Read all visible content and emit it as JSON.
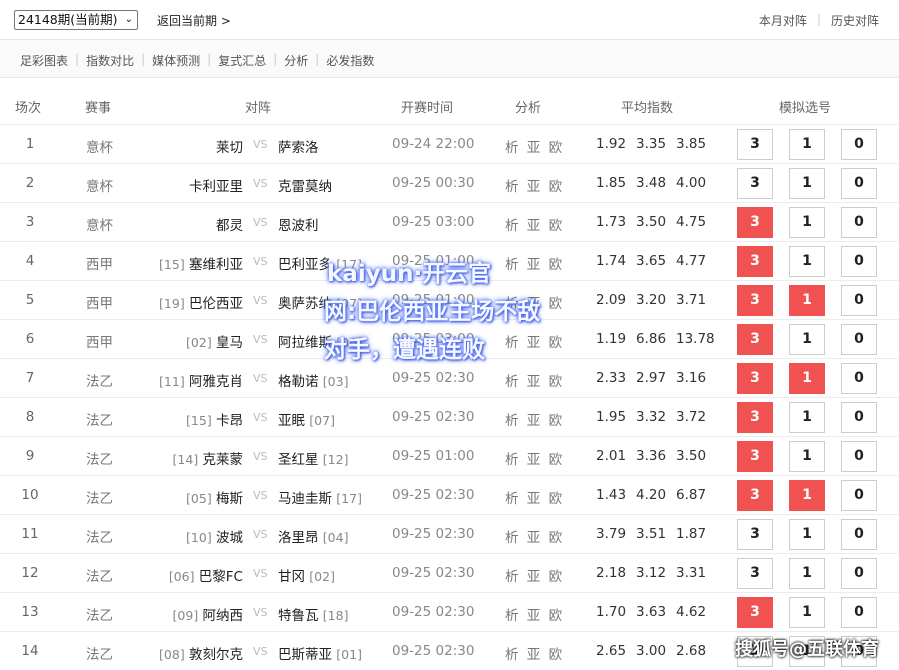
{
  "topbar": {
    "period_select": "24148期(当前期)",
    "period_arrow": "⌄",
    "back_link": "返回当前期 >",
    "right_links": [
      "本月对阵",
      "历史对阵"
    ]
  },
  "subnav": {
    "items": [
      "足彩图表",
      "指数对比",
      "媒体预测",
      "复式汇总",
      "分析",
      "必发指数"
    ]
  },
  "columns": {
    "idx": "场次",
    "league": "赛事",
    "match": "对阵",
    "time": "开赛时间",
    "analysis": "分析",
    "odds": "平均指数",
    "pick": "模拟选号"
  },
  "rows": [
    {
      "idx": "1",
      "league": "意杯",
      "home_rank": "",
      "home": "莱切",
      "vs": "VS",
      "away": "萨索洛",
      "away_rank": "",
      "time": "09-24 22:00",
      "analysis": "析 亚 欧",
      "odds": [
        "1.92",
        "3.35",
        "3.85"
      ],
      "pick": [
        "3",
        "1",
        "0"
      ],
      "selected": [
        false,
        false,
        false
      ]
    },
    {
      "idx": "2",
      "league": "意杯",
      "home_rank": "",
      "home": "卡利亚里",
      "vs": "VS",
      "away": "克雷莫纳",
      "away_rank": "",
      "time": "09-25 00:30",
      "analysis": "析 亚 欧",
      "odds": [
        "1.85",
        "3.48",
        "4.00"
      ],
      "pick": [
        "3",
        "1",
        "0"
      ],
      "selected": [
        false,
        false,
        false
      ]
    },
    {
      "idx": "3",
      "league": "意杯",
      "home_rank": "",
      "home": "都灵",
      "vs": "VS",
      "away": "恩波利",
      "away_rank": "",
      "time": "09-25 03:00",
      "analysis": "析 亚 欧",
      "odds": [
        "1.73",
        "3.50",
        "4.75"
      ],
      "pick": [
        "3",
        "1",
        "0"
      ],
      "selected": [
        true,
        false,
        false
      ]
    },
    {
      "idx": "4",
      "league": "西甲",
      "home_rank": "[15]",
      "home": "塞维利亚",
      "vs": "VS",
      "away": "巴利亚多",
      "away_rank": "[17]",
      "time": "09-25 01:00",
      "analysis": "析 亚 欧",
      "odds": [
        "1.74",
        "3.65",
        "4.77"
      ],
      "pick": [
        "3",
        "1",
        "0"
      ],
      "selected": [
        true,
        false,
        false
      ]
    },
    {
      "idx": "5",
      "league": "西甲",
      "home_rank": "[19]",
      "home": "巴伦西亚",
      "vs": "VS",
      "away": "奥萨苏纳",
      "away_rank": "[07]",
      "time": "09-25 01:00",
      "analysis": "析 亚 欧",
      "odds": [
        "2.09",
        "3.20",
        "3.71"
      ],
      "pick": [
        "3",
        "1",
        "0"
      ],
      "selected": [
        true,
        true,
        false
      ]
    },
    {
      "idx": "6",
      "league": "西甲",
      "home_rank": "[02]",
      "home": "皇马",
      "vs": "VS",
      "away": "阿拉维斯",
      "away_rank": "[06]",
      "time": "09-25 03:00",
      "analysis": "析 亚 欧",
      "odds": [
        "1.19",
        "6.86",
        "13.78"
      ],
      "pick": [
        "3",
        "1",
        "0"
      ],
      "selected": [
        true,
        false,
        false
      ]
    },
    {
      "idx": "7",
      "league": "法乙",
      "home_rank": "[11]",
      "home": "阿雅克肖",
      "vs": "VS",
      "away": "格勒诺",
      "away_rank": "[03]",
      "time": "09-25 02:30",
      "analysis": "析 亚 欧",
      "odds": [
        "2.33",
        "2.97",
        "3.16"
      ],
      "pick": [
        "3",
        "1",
        "0"
      ],
      "selected": [
        true,
        true,
        false
      ]
    },
    {
      "idx": "8",
      "league": "法乙",
      "home_rank": "[15]",
      "home": "卡昂",
      "vs": "VS",
      "away": "亚眠",
      "away_rank": "[07]",
      "time": "09-25 02:30",
      "analysis": "析 亚 欧",
      "odds": [
        "1.95",
        "3.32",
        "3.72"
      ],
      "pick": [
        "3",
        "1",
        "0"
      ],
      "selected": [
        true,
        false,
        false
      ]
    },
    {
      "idx": "9",
      "league": "法乙",
      "home_rank": "[14]",
      "home": "克莱蒙",
      "vs": "VS",
      "away": "圣红星",
      "away_rank": "[12]",
      "time": "09-25 01:00",
      "analysis": "析 亚 欧",
      "odds": [
        "2.01",
        "3.36",
        "3.50"
      ],
      "pick": [
        "3",
        "1",
        "0"
      ],
      "selected": [
        true,
        false,
        false
      ]
    },
    {
      "idx": "10",
      "league": "法乙",
      "home_rank": "[05]",
      "home": "梅斯",
      "vs": "VS",
      "away": "马迪圭斯",
      "away_rank": "[17]",
      "time": "09-25 02:30",
      "analysis": "析 亚 欧",
      "odds": [
        "1.43",
        "4.20",
        "6.87"
      ],
      "pick": [
        "3",
        "1",
        "0"
      ],
      "selected": [
        true,
        true,
        false
      ]
    },
    {
      "idx": "11",
      "league": "法乙",
      "home_rank": "[10]",
      "home": "波城",
      "vs": "VS",
      "away": "洛里昂",
      "away_rank": "[04]",
      "time": "09-25 02:30",
      "analysis": "析 亚 欧",
      "odds": [
        "3.79",
        "3.51",
        "1.87"
      ],
      "pick": [
        "3",
        "1",
        "0"
      ],
      "selected": [
        false,
        false,
        false
      ]
    },
    {
      "idx": "12",
      "league": "法乙",
      "home_rank": "[06]",
      "home": "巴黎FC",
      "vs": "VS",
      "away": "甘冈",
      "away_rank": "[02]",
      "time": "09-25 02:30",
      "analysis": "析 亚 欧",
      "odds": [
        "2.18",
        "3.12",
        "3.31"
      ],
      "pick": [
        "3",
        "1",
        "0"
      ],
      "selected": [
        false,
        false,
        false
      ]
    },
    {
      "idx": "13",
      "league": "法乙",
      "home_rank": "[09]",
      "home": "阿纳西",
      "vs": "VS",
      "away": "特鲁瓦",
      "away_rank": "[18]",
      "time": "09-25 02:30",
      "analysis": "析 亚 欧",
      "odds": [
        "1.70",
        "3.63",
        "4.62"
      ],
      "pick": [
        "3",
        "1",
        "0"
      ],
      "selected": [
        true,
        false,
        false
      ]
    },
    {
      "idx": "14",
      "league": "法乙",
      "home_rank": "[08]",
      "home": "敦刻尔克",
      "vs": "VS",
      "away": "巴斯蒂亚",
      "away_rank": "[01]",
      "time": "09-25 02:30",
      "analysis": "析 亚 欧",
      "odds": [
        "2.65",
        "3.00",
        "2.68"
      ],
      "pick": [
        "3",
        "1",
        "0"
      ],
      "selected": [
        false,
        false,
        false
      ]
    }
  ],
  "watermark": {
    "line1": "kaiyun·开云官",
    "line2": "网:巴伦西亚主场不敌",
    "line3": "对手，遭遇连败"
  },
  "credit": "搜狐号@五联体育",
  "colors": {
    "selected_pick": "#f05151",
    "watermark_glow": "#4a6cf7"
  }
}
